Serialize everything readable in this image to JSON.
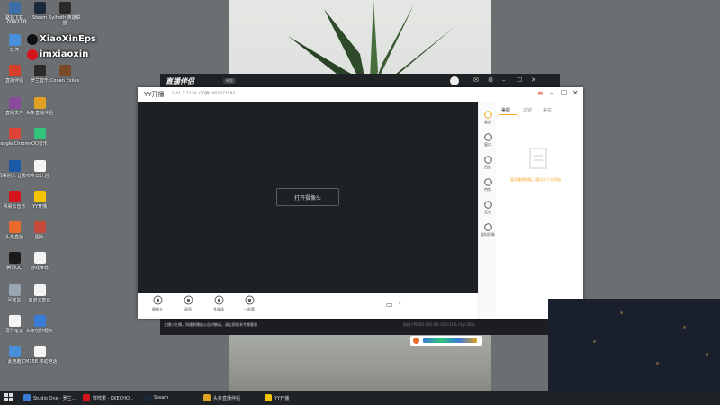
{
  "desktop": {
    "icons": [
      {
        "label": "路标下载",
        "color": "#3a6ea5"
      },
      {
        "label": "Steam",
        "color": "#1b2838"
      },
      {
        "label": "Sylheth 英雄联盟",
        "color": "#2a2a2a"
      },
      {
        "label": "软件",
        "color": "#4a90d9"
      },
      {
        "label": "Conan Exiles",
        "color": "#7a4a2a"
      },
      {
        "label": "直播伴侣",
        "color": "#d43f2a"
      },
      {
        "label": "罗兰音乐",
        "color": "#2b2b2b"
      },
      {
        "label": "直播文件",
        "color": "#8a4a9a"
      },
      {
        "label": "头条直播伴侣",
        "color": "#e0a020"
      },
      {
        "label": "Google Chrome",
        "color": "#db4437"
      },
      {
        "label": "QQ音乐",
        "color": "#31c27c"
      },
      {
        "label": "同事别人 让发布",
        "color": "#1a5aa8"
      },
      {
        "label": "今日计划",
        "color": "#f5f5f5"
      },
      {
        "label": "网易云音乐",
        "color": "#d5141e"
      },
      {
        "label": "YY开播",
        "color": "#f5c400"
      },
      {
        "label": "头条直播",
        "color": "#e96a2a"
      },
      {
        "label": "图片",
        "color": "#c84a3a"
      },
      {
        "label": "腾讯QQ",
        "color": "#1a1a1a"
      },
      {
        "label": "游戏推荐",
        "color": "#f5f5f5"
      },
      {
        "label": "回收站",
        "color": "#9aa6b2"
      },
      {
        "label": "有道云笔记",
        "color": "#f5f5f5"
      },
      {
        "label": "写作笔记",
        "color": "#f5f5f5"
      },
      {
        "label": "头条创作服务",
        "color": "#3a7ad9"
      },
      {
        "label": "此电脑",
        "color": "#4a90d9"
      },
      {
        "label": "CM158 移动电话",
        "color": "#f5f5f5"
      }
    ],
    "date_fragment": "709710"
  },
  "overlay": {
    "line1": "XiaoXinEps",
    "line2": "imxiaoxin"
  },
  "back_window": {
    "logo": "直播伴侣",
    "version_badge": "新版",
    "notice": "主播小主播，如遇到播放公告时敬请，请立即联系专属客服",
    "stats": "网络 FPS:60   CPU:6%   GPU:11%   内存:28%"
  },
  "main_window": {
    "app_name": "YY开播",
    "version": "1.41.2.2229",
    "qq_label": "QQ群: 905371593",
    "open_camera": "打开摄像头",
    "tools": [
      {
        "label": "摄像头",
        "icon": "camera-icon"
      },
      {
        "label": "画面",
        "icon": "screen-icon"
      },
      {
        "label": "多媒体",
        "icon": "media-icon"
      },
      {
        "label": "一起看",
        "icon": "watch-together-icon"
      }
    ],
    "side_items": [
      {
        "label": "美颜",
        "icon": "beauty-icon"
      },
      {
        "label": "窗口",
        "icon": "layers-icon"
      },
      {
        "label": "回放",
        "icon": "replay-icon"
      },
      {
        "label": "特效",
        "icon": "effects-icon"
      },
      {
        "label": "音效",
        "icon": "audio-icon"
      },
      {
        "label": "虚拟形象",
        "icon": "avatar-icon"
      }
    ],
    "panel_tabs": [
      "美颜",
      "滤镜",
      "美妆"
    ],
    "empty_hint": "暂无美颜数据，请点击下方添加"
  },
  "taskbar": {
    "items": [
      {
        "label": "Studio One - 罗兰...",
        "color": "#3a7bd5"
      },
      {
        "label": "咩咩果 - KKECHO...",
        "color": "#d5141e"
      },
      {
        "label": "Steam",
        "color": "#1b2838"
      },
      {
        "label": "头条直播伴侣",
        "color": "#e0a020"
      },
      {
        "label": "YY开播",
        "color": "#f5c400"
      }
    ]
  },
  "colors": {
    "accent_orange": "#f5a623",
    "preview_bg": "#1d2024",
    "taskbar_bg": "#1f2326"
  }
}
